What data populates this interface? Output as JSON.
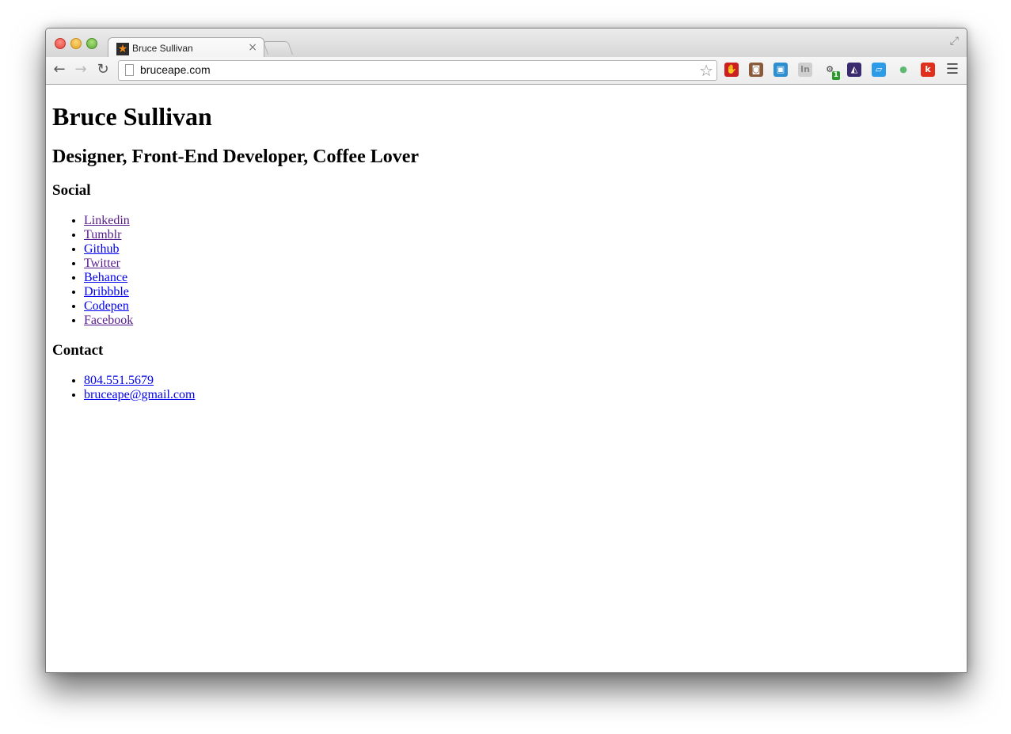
{
  "browser": {
    "tab": {
      "title": "Bruce Sullivan",
      "close": "×"
    },
    "address": {
      "url": "bruceape.com"
    },
    "extensions": [
      {
        "name": "adblock-icon",
        "glyph": "✋",
        "bg": "#cc1f1f",
        "color": "#ffffff"
      },
      {
        "name": "instagram-icon",
        "glyph": "◙",
        "bg": "#8a5a3c",
        "color": "#ffffff"
      },
      {
        "name": "screenshot-icon",
        "glyph": "▣",
        "bg": "#2d8fd0",
        "color": "#ffffff"
      },
      {
        "name": "invision-icon",
        "glyph": "In",
        "bg": "#cfcfcf",
        "color": "#888888"
      },
      {
        "name": "settings-icon",
        "glyph": "⚙",
        "bg": "transparent",
        "color": "#333333",
        "badge": "1"
      },
      {
        "name": "zoom-icon",
        "glyph": "◭",
        "bg": "#3a2b6e",
        "color": "#ffffff"
      },
      {
        "name": "page-ruler-icon",
        "glyph": "▱",
        "bg": "#2c9be8",
        "color": "#ffffff"
      },
      {
        "name": "evernote-icon",
        "glyph": "●",
        "bg": "transparent",
        "color": "#5db870"
      },
      {
        "name": "klout-icon",
        "glyph": "k",
        "bg": "#e02f1c",
        "color": "#ffffff"
      }
    ]
  },
  "page": {
    "name": "Bruce Sullivan",
    "tagline": "Designer, Front-End Developer, Coffee Lover",
    "social_heading": "Social",
    "social_links": [
      {
        "label": "Linkedin",
        "visited": true
      },
      {
        "label": "Tumblr",
        "visited": true
      },
      {
        "label": "Github",
        "visited": false
      },
      {
        "label": "Twitter",
        "visited": true
      },
      {
        "label": "Behance",
        "visited": false
      },
      {
        "label": "Dribbble",
        "visited": false
      },
      {
        "label": "Codepen",
        "visited": false
      },
      {
        "label": "Facebook",
        "visited": true
      }
    ],
    "contact_heading": "Contact",
    "contact_links": [
      {
        "label": "804.551.5679"
      },
      {
        "label": "bruceape@gmail.com"
      }
    ]
  }
}
